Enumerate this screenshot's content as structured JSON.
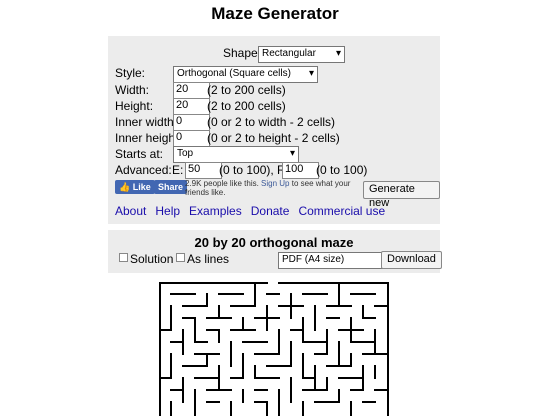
{
  "title": "Maze Generator",
  "shape": {
    "label": "Shape:",
    "value": "Rectangular"
  },
  "style": {
    "label": "Style:",
    "value": "Orthogonal (Square cells)"
  },
  "width": {
    "label": "Width:",
    "value": "20",
    "hint": "(2 to 200 cells)"
  },
  "height": {
    "label": "Height:",
    "value": "20",
    "hint": "(2 to 200 cells)"
  },
  "inner_width": {
    "label": "Inner width:",
    "value": "0",
    "hint": "(0 or 2 to width - 2 cells)"
  },
  "inner_height": {
    "label": "Inner height:",
    "value": "0",
    "hint": "(0 or 2 to height - 2 cells)"
  },
  "starts_at": {
    "label": "Starts at:",
    "value": "Top"
  },
  "advanced": {
    "label": "Advanced:",
    "e_label": "E:",
    "e_value": "50",
    "e_hint": "(0 to 100), R:",
    "r_value": "100",
    "r_hint": "(0 to 100)"
  },
  "social": {
    "like": "Like",
    "share": "Share",
    "text1": "2.9K people like this. ",
    "signup": "Sign Up",
    "text2": " to see what your friends like."
  },
  "generate_label": "Generate new",
  "links": [
    "About",
    "Help",
    "Examples",
    "Donate",
    "Commercial use"
  ],
  "maze_heading": "20 by 20 orthogonal maze",
  "solution_label": "Solution",
  "aslines_label": "As lines",
  "format": {
    "value": "PDF (A4 size)"
  },
  "download_label": "Download",
  "colors": {
    "panel": "#ececec",
    "facebook": "#4267b2",
    "link": "#1a0dab"
  }
}
